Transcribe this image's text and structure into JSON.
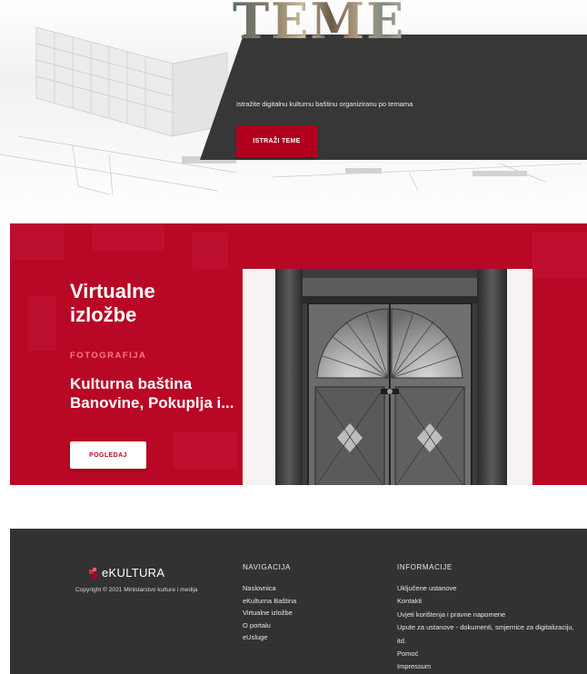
{
  "hero": {
    "title": "TEME",
    "subtitle": "Istražite digitalnu kulturnu baštinu organiziranu po temama",
    "button_label": "ISTRAŽI TEME"
  },
  "exhibit": {
    "section_title": "Virtualne izložbe",
    "category": "FOTOGRAFIJA",
    "name": "Kulturna baština Banovine, Pokuplja i...",
    "button_label": "POGLEDAJ"
  },
  "footer": {
    "logo_text": "eKULTURA",
    "copyright": "Copyright © 2021 Ministarstvo kulture i medija",
    "navigation": {
      "heading": "NAVIGACIJA",
      "items": [
        "Naslovnica",
        "eKulturna Baština",
        "Virtualne izložbe",
        "O portalu",
        "eUsluge"
      ]
    },
    "information": {
      "heading": "INFORMACIJE",
      "items": [
        "Uključene ustanove",
        "Kontakti",
        "Uvjeti korištenja i pravne napomene",
        "Upute za ustanove - dokumenti, smjernice za digitalizaciju, itd.",
        "Pomoć",
        "Impressum"
      ]
    }
  },
  "colors": {
    "accent_red": "#b0001e",
    "exhibit_red": "#b80826",
    "dark_band": "#373737",
    "footer_bg": "#333232"
  }
}
